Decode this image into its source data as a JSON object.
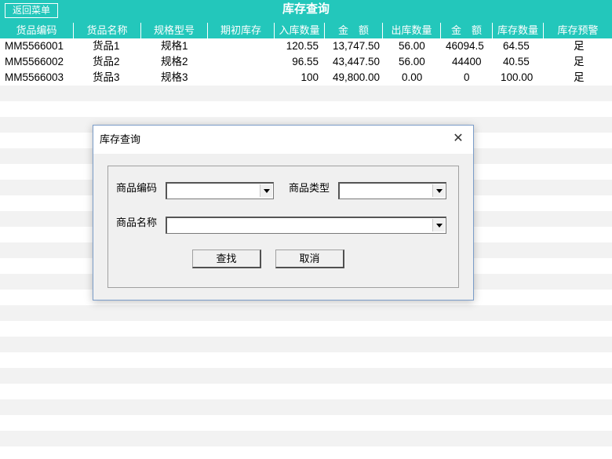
{
  "header": {
    "back_label": "返回菜单",
    "title": "库存查询"
  },
  "columns": [
    "货品编码",
    "货品名称",
    "规格型号",
    "期初库存",
    "入库数量",
    "金　额",
    "出库数量",
    "金　额",
    "库存数量",
    "库存预警"
  ],
  "rows": [
    [
      "MM5566001",
      "货品1",
      "规格1",
      "",
      "120.55",
      "13,747.50",
      "56.00",
      "46094.5",
      "64.55",
      "足"
    ],
    [
      "MM5566002",
      "货品2",
      "规格2",
      "",
      "96.55",
      "43,447.50",
      "56.00",
      "44400",
      "40.55",
      "足"
    ],
    [
      "MM5566003",
      "货品3",
      "规格3",
      "",
      "100",
      "49,800.00",
      "0.00",
      "0",
      "100.00",
      "足"
    ]
  ],
  "dialog": {
    "title": "库存查询",
    "close_icon": "close-icon",
    "code_label": "商品编码",
    "code_value": "",
    "type_label": "商品类型",
    "type_value": "",
    "name_label": "商品名称",
    "name_value": "",
    "search_label": "查找",
    "cancel_label": "取消"
  },
  "colors": {
    "accent": "#23c7bb",
    "stripe": "#f2f2f2"
  }
}
